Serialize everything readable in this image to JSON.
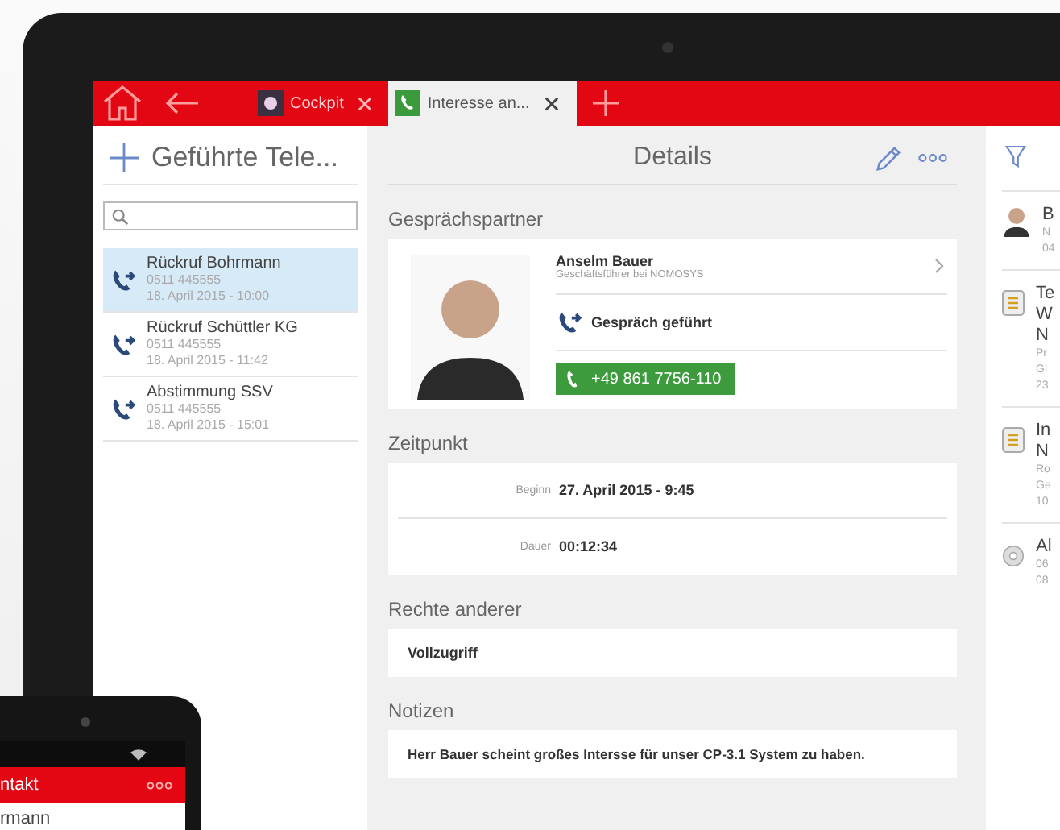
{
  "tabs": [
    {
      "label": "Cockpit",
      "kind": "app",
      "selected": false
    },
    {
      "label": "Interesse an...",
      "kind": "call",
      "selected": true
    }
  ],
  "list": {
    "title": "Geführte Tele...",
    "items": [
      {
        "title": "Rückruf Bohrmann",
        "phone": "0511 445555",
        "date": "18. April 2015 - 10:00",
        "selected": true
      },
      {
        "title": "Rückruf Schüttler KG",
        "phone": "0511 445555",
        "date": "18. April 2015 - 11:42",
        "selected": false
      },
      {
        "title": "Abstimmung SSV",
        "phone": "0511 445555",
        "date": "18. April 2015 - 15:01",
        "selected": false
      }
    ]
  },
  "details": {
    "title": "Details",
    "partner": {
      "heading": "Gesprächspartner",
      "name": "Anselm Bauer",
      "role": "Geschäftsführer bei NOMOSYS",
      "status": "Gespräch geführt",
      "phone": "+49 861 7756-110"
    },
    "time": {
      "heading": "Zeitpunkt",
      "rows": [
        {
          "label": "Beginn",
          "value": "27. April 2015 - 9:45"
        },
        {
          "label": "Dauer",
          "value": "00:12:34"
        }
      ]
    },
    "rights": {
      "heading": "Rechte anderer",
      "value": "Vollzugriff"
    },
    "notes": {
      "heading": "Notizen",
      "value": "Herr Bauer scheint großes Intersse für unser CP-3.1 System zu haben."
    }
  },
  "right_panel": {
    "items": [
      {
        "kind": "person",
        "title_lines": [
          "B"
        ],
        "meta_lines": [
          "N",
          "04"
        ]
      },
      {
        "kind": "document",
        "title_lines": [
          "Te",
          "W",
          "N"
        ],
        "meta_lines": [
          "Pr",
          "Gl",
          "23"
        ]
      },
      {
        "kind": "document",
        "title_lines": [
          "In",
          "N"
        ],
        "meta_lines": [
          "Ro",
          "Ge",
          "10"
        ]
      },
      {
        "kind": "disc",
        "title_lines": [
          "Al"
        ],
        "meta_lines": [
          "06",
          "08"
        ]
      }
    ]
  },
  "phone": {
    "title": "ntakt",
    "row": "rmann"
  }
}
